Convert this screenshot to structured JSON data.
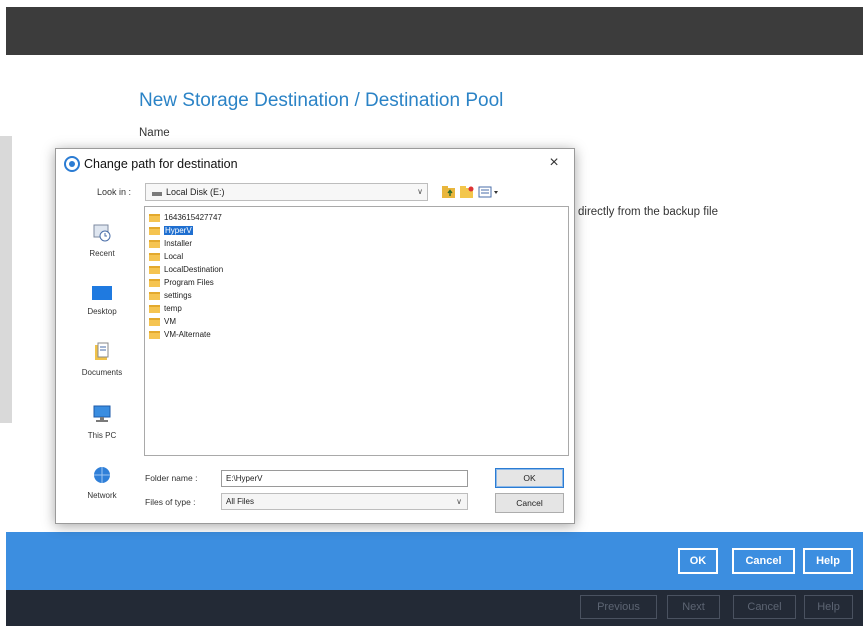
{
  "page": {
    "title": "New Storage Destination / Destination Pool",
    "name_label": "Name",
    "background_hint": "directly from the backup file"
  },
  "dialog": {
    "title": "Change path for destination",
    "close_glyph": "×",
    "look_in_label": "Look in :",
    "look_in_value": "Local Disk (E:)",
    "places": [
      {
        "label": "Recent",
        "icon": "recent-icon"
      },
      {
        "label": "Desktop",
        "icon": "desktop-icon"
      },
      {
        "label": "Documents",
        "icon": "documents-icon"
      },
      {
        "label": "This PC",
        "icon": "computer-icon"
      },
      {
        "label": "Network",
        "icon": "network-icon"
      }
    ],
    "folders": [
      "1643615427747",
      "HyperV",
      "Installer",
      "Local",
      "LocalDestination",
      "Program Files",
      "settings",
      "temp",
      "VM",
      "VM-Alternate"
    ],
    "selected_folder": "HyperV",
    "folder_name_label": "Folder name :",
    "folder_name_value": "E:\\HyperV",
    "files_of_type_label": "Files of type :",
    "files_of_type_value": "All Files",
    "ok_label": "OK",
    "cancel_label": "Cancel"
  },
  "footer": {
    "ok_label": "OK",
    "cancel_label": "Cancel",
    "help_label": "Help"
  },
  "wizard_nav": {
    "previous_label": "Previous",
    "next_label": "Next",
    "cancel_label": "Cancel",
    "help_label": "Help"
  },
  "colors": {
    "accent_blue": "#3c8ee0",
    "title_blue": "#2b83c6",
    "selection_blue": "#1f6fd0",
    "top_bar": "#3c3c3c",
    "bottom_bar": "#232a36",
    "folder_yellow": "#f5c451"
  }
}
